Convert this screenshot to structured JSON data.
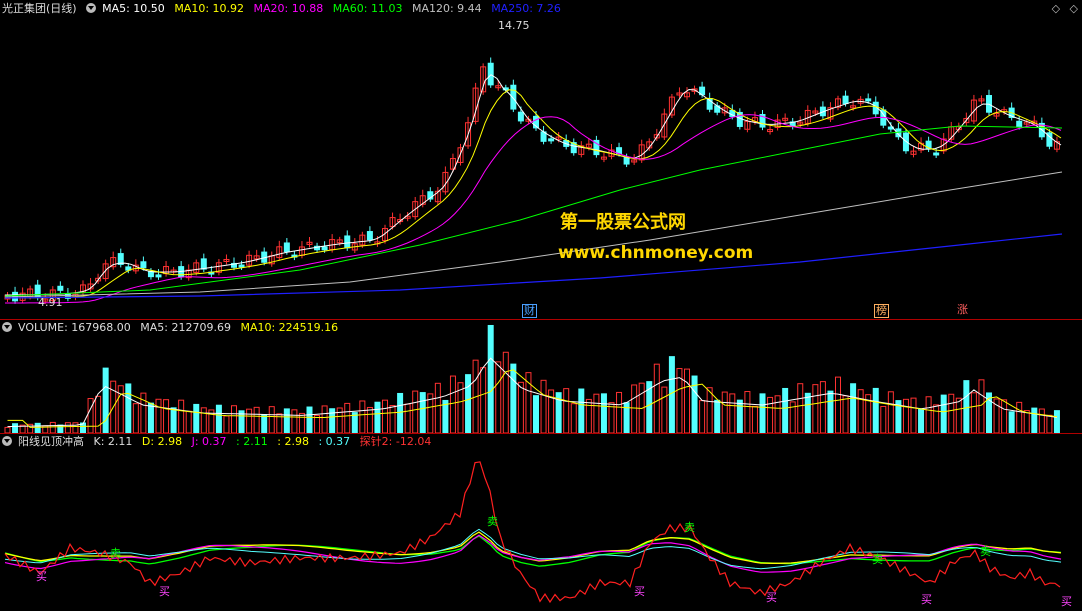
{
  "price_header": {
    "title": "光正集团(日线)",
    "ma5": "MA5: 10.50",
    "ma10": "MA10: 10.92",
    "ma20": "MA20: 10.88",
    "ma60": "MA60: 11.03",
    "ma120": "MA120: 9.44",
    "ma250": "MA250: 7.26"
  },
  "nav": {
    "prev": "◇",
    "next": "◇"
  },
  "price_marks": {
    "high": "14.75",
    "low": "4.91"
  },
  "events": {
    "e1": "财",
    "e2": "榜",
    "e3": "涨"
  },
  "watermark": {
    "line1": "第一股票公式网",
    "line2": "www.chnmoney.com"
  },
  "volume_header": {
    "volume": "VOLUME: 167968.00",
    "ma5": "MA5: 212709.69",
    "ma10": "MA10: 224519.16"
  },
  "indicator_header": {
    "name": "阳线见顶冲高",
    "k": "K: 2.11",
    "d": "D: 2.98",
    "j": "J: 0.37",
    "v1": ": 2.11",
    "v2": ": 2.98",
    "v3": ": 0.37",
    "probe": "探针2: -12.04"
  },
  "signals": {
    "buy": "买",
    "sell": "卖"
  },
  "colors": {
    "up": "#ff3232",
    "down": "#54ffff",
    "ma5": "#ffffff",
    "ma10": "#ffff00",
    "ma20": "#ff00ff",
    "ma60": "#00ff00",
    "ma120": "#c0c0c0",
    "ma250": "#1f1fff",
    "separator": "#b00000"
  }
}
